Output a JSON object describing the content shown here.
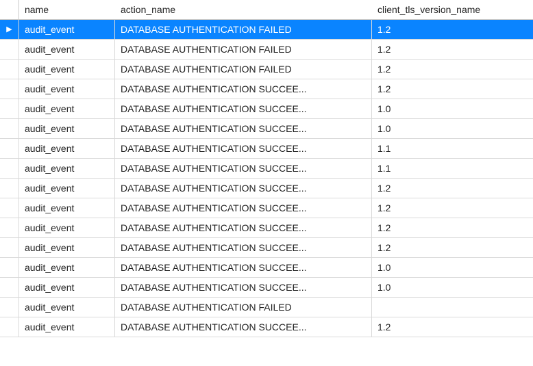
{
  "table": {
    "columns": {
      "name": "name",
      "action_name": "action_name",
      "client_tls_version_name": "client_tls_version_name"
    },
    "selected_index": 0,
    "rows": [
      {
        "name": "audit_event",
        "action_name": "DATABASE AUTHENTICATION FAILED",
        "client_tls_version_name": "1.2"
      },
      {
        "name": "audit_event",
        "action_name": "DATABASE AUTHENTICATION FAILED",
        "client_tls_version_name": "1.2"
      },
      {
        "name": "audit_event",
        "action_name": "DATABASE AUTHENTICATION FAILED",
        "client_tls_version_name": "1.2"
      },
      {
        "name": "audit_event",
        "action_name": "DATABASE AUTHENTICATION SUCCEE...",
        "client_tls_version_name": "1.2"
      },
      {
        "name": "audit_event",
        "action_name": "DATABASE AUTHENTICATION SUCCEE...",
        "client_tls_version_name": "1.0"
      },
      {
        "name": "audit_event",
        "action_name": "DATABASE AUTHENTICATION SUCCEE...",
        "client_tls_version_name": "1.0"
      },
      {
        "name": "audit_event",
        "action_name": "DATABASE AUTHENTICATION SUCCEE...",
        "client_tls_version_name": "1.1"
      },
      {
        "name": "audit_event",
        "action_name": "DATABASE AUTHENTICATION SUCCEE...",
        "client_tls_version_name": "1.1"
      },
      {
        "name": "audit_event",
        "action_name": "DATABASE AUTHENTICATION SUCCEE...",
        "client_tls_version_name": "1.2"
      },
      {
        "name": "audit_event",
        "action_name": "DATABASE AUTHENTICATION SUCCEE...",
        "client_tls_version_name": "1.2"
      },
      {
        "name": "audit_event",
        "action_name": "DATABASE AUTHENTICATION SUCCEE...",
        "client_tls_version_name": "1.2"
      },
      {
        "name": "audit_event",
        "action_name": "DATABASE AUTHENTICATION SUCCEE...",
        "client_tls_version_name": "1.2"
      },
      {
        "name": "audit_event",
        "action_name": "DATABASE AUTHENTICATION SUCCEE...",
        "client_tls_version_name": "1.0"
      },
      {
        "name": "audit_event",
        "action_name": "DATABASE AUTHENTICATION SUCCEE...",
        "client_tls_version_name": "1.0"
      },
      {
        "name": "audit_event",
        "action_name": "DATABASE AUTHENTICATION FAILED",
        "client_tls_version_name": ""
      },
      {
        "name": "audit_event",
        "action_name": "DATABASE AUTHENTICATION SUCCEE...",
        "client_tls_version_name": "1.2"
      }
    ]
  }
}
